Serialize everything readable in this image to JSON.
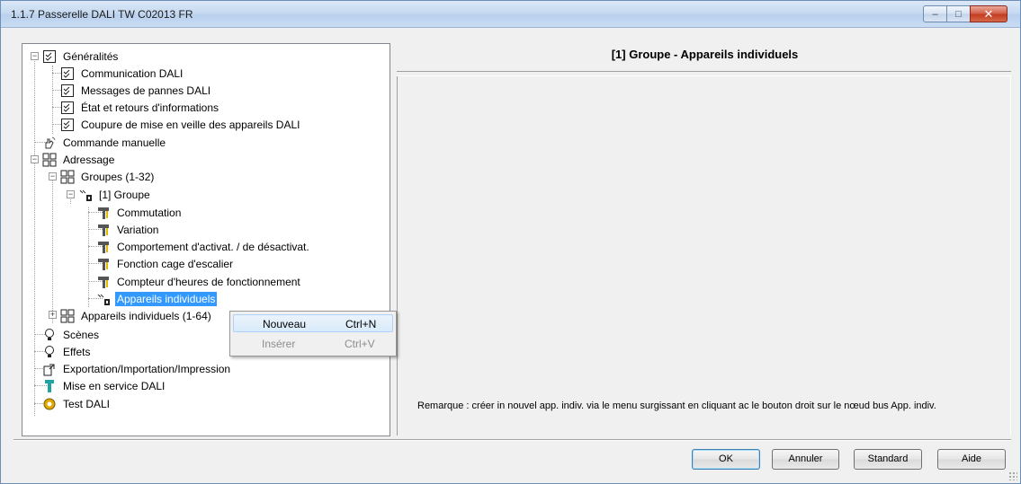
{
  "window": {
    "title": "1.1.7 Passerelle DALI TW C02013 FR",
    "buttons": {
      "minimize": "–",
      "maximize": "□",
      "close": "✕"
    }
  },
  "tree": {
    "items": [
      {
        "label": "Généralités",
        "icon": "checklist-icon"
      },
      {
        "label": "Communication DALI",
        "icon": "checklist-icon"
      },
      {
        "label": "Messages de pannes DALI",
        "icon": "checklist-icon"
      },
      {
        "label": "État et retours d'informations",
        "icon": "checklist-icon"
      },
      {
        "label": "Coupure de mise en veille des appareils DALI",
        "icon": "checklist-icon"
      },
      {
        "label": "Commande manuelle",
        "icon": "hand-icon"
      },
      {
        "label": "Adressage",
        "icon": "grid-icon"
      },
      {
        "label": "Groupes (1-32)",
        "icon": "grid-icon"
      },
      {
        "label": "[1] Groupe",
        "icon": "group-device-icon"
      },
      {
        "label": "Commutation",
        "icon": "tool-icon"
      },
      {
        "label": "Variation",
        "icon": "tool-icon"
      },
      {
        "label": "Comportement d'activat. / de désactivat.",
        "icon": "tool-icon"
      },
      {
        "label": "Fonction cage d'escalier",
        "icon": "tool-icon"
      },
      {
        "label": "Compteur d'heures de fonctionnement",
        "icon": "tool-icon"
      },
      {
        "label": "Appareils individuels",
        "icon": "group-device-icon",
        "selected": true
      },
      {
        "label": "Appareils individuels (1-64)",
        "icon": "grid-icon"
      },
      {
        "label": "Scènes",
        "icon": "bulb-icon"
      },
      {
        "label": "Effets",
        "icon": "bulb-icon"
      },
      {
        "label": "Exportation/Importation/Impression",
        "icon": "export-icon"
      },
      {
        "label": "Mise en service DALI",
        "icon": "wrench-icon"
      },
      {
        "label": "Test DALI",
        "icon": "gear-icon"
      }
    ]
  },
  "context_menu": {
    "items": [
      {
        "label": "Nouveau",
        "shortcut": "Ctrl+N",
        "enabled": true
      },
      {
        "label": "Insérer",
        "shortcut": "Ctrl+V",
        "enabled": false
      }
    ]
  },
  "right_panel": {
    "header": "[1] Groupe - Appareils individuels",
    "remark": "Remarque : créer in nouvel app. indiv. via le menu surgissant en cliquant ac le  bouton droit sur le nœud bus App. indiv."
  },
  "footer": {
    "ok": "OK",
    "cancel": "Annuler",
    "standard": "Standard",
    "help": "Aide"
  },
  "colors": {
    "selection": "#3399ff",
    "title_bar": "#c7daf1",
    "close_button": "#c23c20"
  }
}
